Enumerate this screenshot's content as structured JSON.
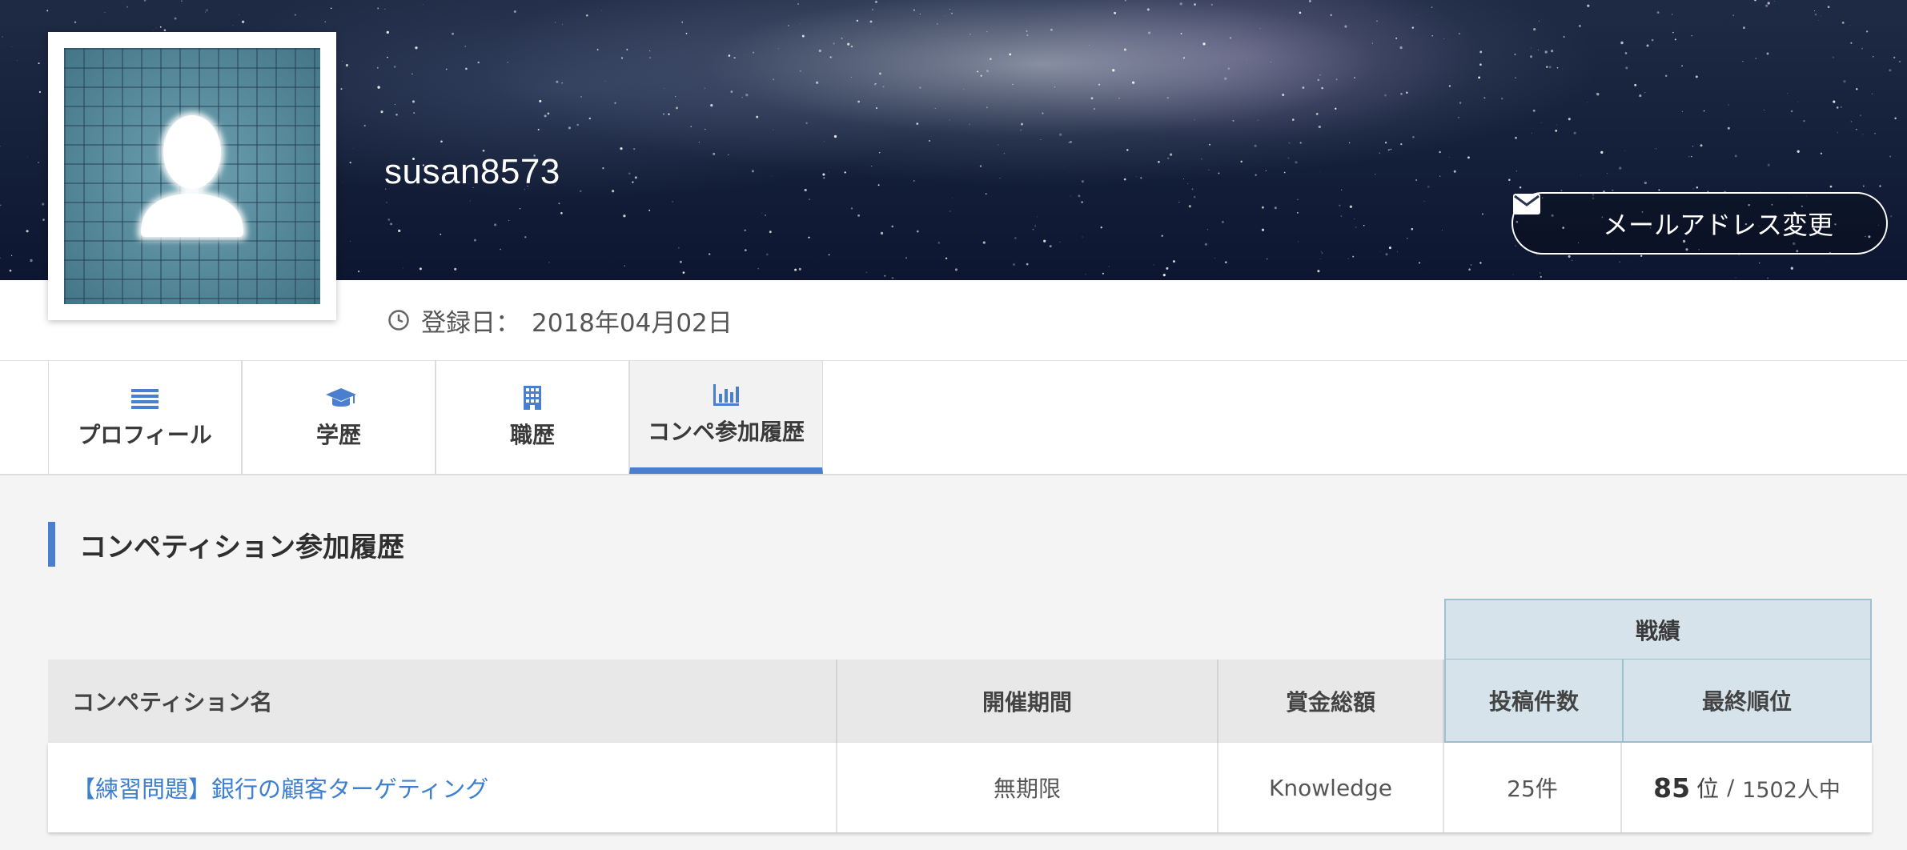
{
  "profile": {
    "username": "susan8573",
    "email_button_label": "メールアドレス変更",
    "registration_label": "登録日：",
    "registration_date": "2018年04月02日"
  },
  "tabs": [
    {
      "label": "プロフィール",
      "icon": "list-icon",
      "active": false
    },
    {
      "label": "学歴",
      "icon": "graduation-cap-icon",
      "active": false
    },
    {
      "label": "職歴",
      "icon": "building-icon",
      "active": false
    },
    {
      "label": "コンペ参加履歴",
      "icon": "bar-chart-icon",
      "active": true
    }
  ],
  "section": {
    "title": "コンペティション参加履歴"
  },
  "table": {
    "group_header": "戦績",
    "columns": {
      "name": "コンペティション名",
      "period": "開催期間",
      "prize": "賞金総額",
      "submissions": "投稿件数",
      "rank": "最終順位"
    },
    "rows": [
      {
        "name": "【練習問題】銀行の顧客ターゲティング",
        "period": "無期限",
        "prize": "Knowledge",
        "submissions": "25件",
        "rank": "85",
        "rank_unit": "位",
        "rank_separator": "/",
        "rank_total": "1502人中"
      }
    ]
  },
  "colors": {
    "accent": "#4a7fd0",
    "link": "#3f7fd0",
    "results_header_bg": "#d6e3ea"
  }
}
